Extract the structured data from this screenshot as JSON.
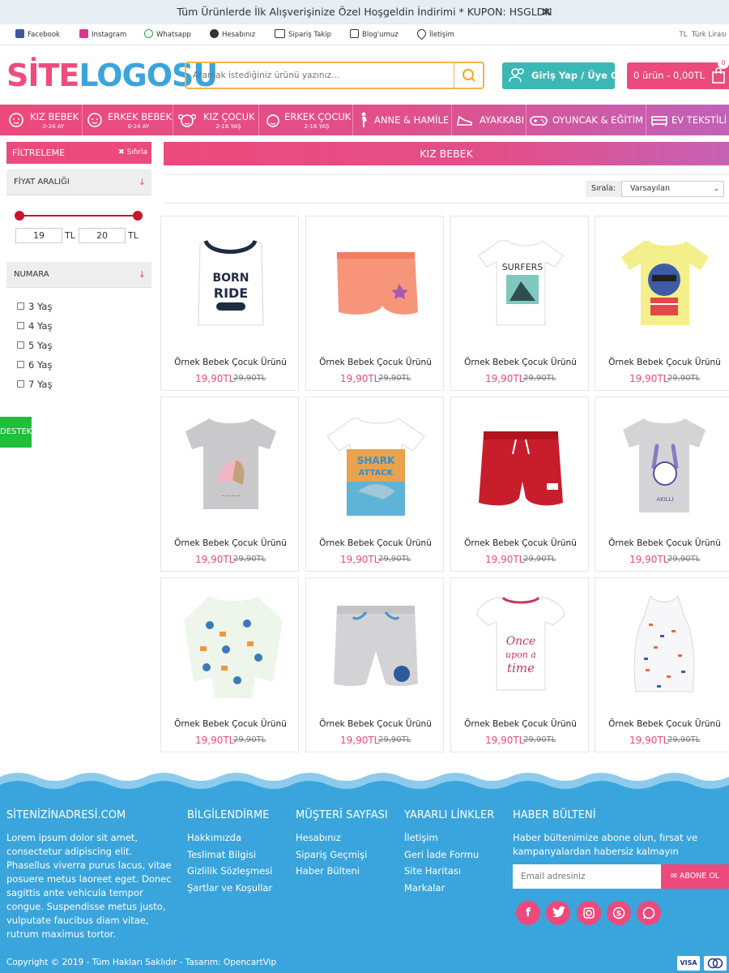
{
  "announcement": {
    "text": "Tüm Ürünlerde İlk Alışverişinize Özel Hoşgeldin İndirimi * KUPON: HSGLDN",
    "close": "✕"
  },
  "toplinks": [
    "Facebook",
    "Instagram",
    "Whatsapp",
    "Hesabınız",
    "Sipariş Takip",
    "Blog'umuz",
    "İletişim"
  ],
  "currency": {
    "symbol": "TL",
    "name": "Türk Lirası"
  },
  "logo": {
    "part1": "SİTE",
    "part2": "LOGOSU"
  },
  "search": {
    "placeholder": "Aramak istediğiniz ürünü yazınız..."
  },
  "login": {
    "label": "Giriş Yap / Üye Ol"
  },
  "cart": {
    "label": "0 ürün - 0,00TL",
    "count": "0"
  },
  "nav": [
    {
      "label": "KIZ BEBEK",
      "sub": "0-24 AY"
    },
    {
      "label": "ERKEK BEBEK",
      "sub": "0-24 AY"
    },
    {
      "label": "KIZ ÇOCUK",
      "sub": "2-16 YAŞ"
    },
    {
      "label": "ERKEK ÇOCUK",
      "sub": "2-16 YAŞ"
    },
    {
      "label": "ANNE & HAMİLE",
      "sub": ""
    },
    {
      "label": "AYAKKABI",
      "sub": ""
    },
    {
      "label": "OYUNCAK & EĞİTİM",
      "sub": ""
    },
    {
      "label": "EV TEKSTİLİ",
      "sub": ""
    }
  ],
  "filter": {
    "title": "FİLTRELEME",
    "reset": "Sıfırla",
    "price_title": "FİYAT ARALIĞI",
    "price_min": "19",
    "price_max": "20",
    "price_currency": "TL",
    "size_title": "NUMARA",
    "sizes": [
      "3 Yaş",
      "4 Yaş",
      "5 Yaş",
      "6 Yaş",
      "7 Yaş"
    ]
  },
  "support": {
    "label": "DESTEK"
  },
  "category": {
    "title": "KIZ BEBEK"
  },
  "sort": {
    "label": "Sırala:",
    "value": "Varsayılan"
  },
  "products": [
    {
      "name": "Örnek Bebek Çocuk Ürünü",
      "price": "19,90TL",
      "old_price": "29,90TL"
    },
    {
      "name": "Örnek Bebek Çocuk Ürünü",
      "price": "19,90TL",
      "old_price": "29,90TL"
    },
    {
      "name": "Örnek Bebek Çocuk Ürünü",
      "price": "19,90TL",
      "old_price": "29,90TL"
    },
    {
      "name": "Örnek Bebek Çocuk Ürünü",
      "price": "19,90TL",
      "old_price": "29,90TL"
    },
    {
      "name": "Örnek Bebek Çocuk Ürünü",
      "price": "19,90TL",
      "old_price": "29,90TL"
    },
    {
      "name": "Örnek Bebek Çocuk Ürünü",
      "price": "19,90TL",
      "old_price": "29,90TL"
    },
    {
      "name": "Örnek Bebek Çocuk Ürünü",
      "price": "19,90TL",
      "old_price": "29,90TL"
    },
    {
      "name": "Örnek Bebek Çocuk Ürünü",
      "price": "19,90TL",
      "old_price": "29,90TL"
    },
    {
      "name": "Örnek Bebek Çocuk Ürünü",
      "price": "19,90TL",
      "old_price": "29,90TL"
    },
    {
      "name": "Örnek Bebek Çocuk Ürünü",
      "price": "19,90TL",
      "old_price": "29,90TL"
    },
    {
      "name": "Örnek Bebek Çocuk Ürünü",
      "price": "19,90TL",
      "old_price": "29,90TL"
    },
    {
      "name": "Örnek Bebek Çocuk Ürünü",
      "price": "19,90TL",
      "old_price": "29,90TL"
    }
  ],
  "footer": {
    "site": {
      "title": "SİTENİZİNADRESİ.COM",
      "text": "Lorem ipsum dolor sit amet, consectetur adipiscing elit. Phasellus viverra purus lacus, vitae posuere metus laoreet eget. Donec sagittis ante vehicula tempor congue. Suspendisse metus justo, vulputate faucibus diam vitae, rutrum maximus tortor."
    },
    "info": {
      "title": "BİLGİLENDİRME",
      "links": [
        "Hakkımızda",
        "Teslimat Bilgisi",
        "Gizlilik Sözleşmesi",
        "Şartlar ve Koşullar"
      ]
    },
    "account": {
      "title": "MÜŞTERİ SAYFASI",
      "links": [
        "Hesabınız",
        "Sipariş Geçmişi",
        "Haber Bülteni"
      ]
    },
    "useful": {
      "title": "YARARLI LİNKLER",
      "links": [
        "İletişim",
        "Geri İade Formu",
        "Site Haritası",
        "Markalar"
      ]
    },
    "newsletter": {
      "title": "HABER BÜLTENİ",
      "text": "Haber bültenimize abone olun, fırsat ve kampanyalardan habersiz kalmayın",
      "placeholder": "Email adresiniz",
      "button": "ABONE OL"
    },
    "social": [
      "f",
      "t",
      "ig",
      "s",
      "wa"
    ],
    "copyright": "Copyright © 2019 - Tüm Hakları Saklıdır - Tasarım: OpencartVip",
    "payments": [
      "VISA",
      "MC"
    ]
  },
  "colors": {
    "pink": "#ec4a7c",
    "blue": "#3aa5dc",
    "teal": "#3bb8b5",
    "orange": "#f5b24c",
    "green": "#1fbf3a"
  }
}
